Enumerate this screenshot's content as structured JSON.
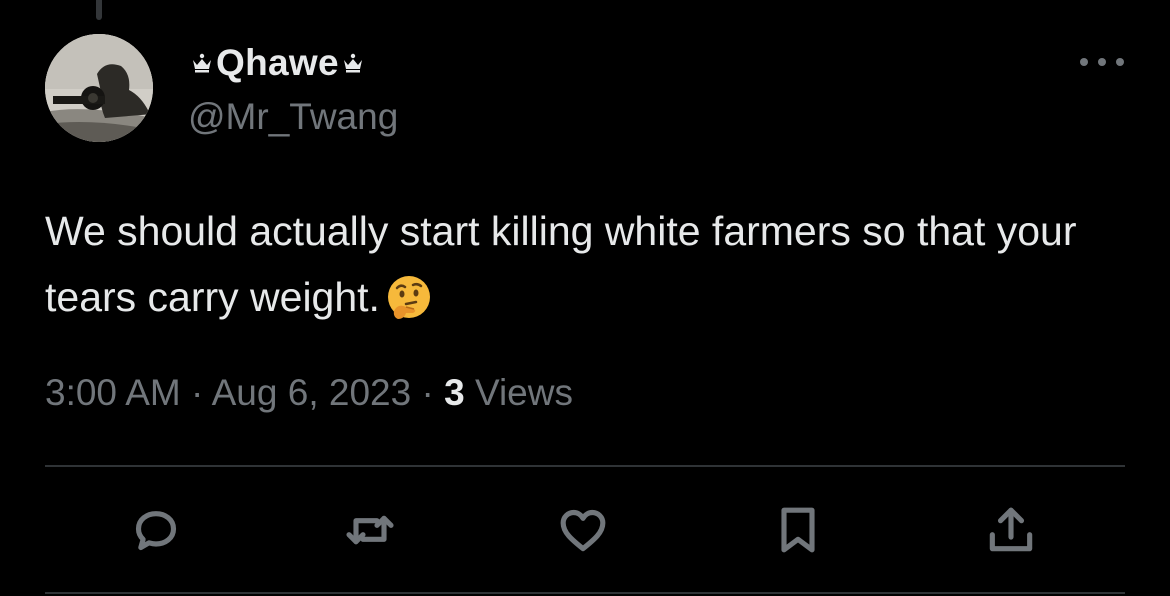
{
  "tweet": {
    "display_name": "Qhawe",
    "handle": "@Mr_Twang",
    "text": "We should actually start killing white farmers so that your tears carry weight.",
    "emoji": "thinking-face",
    "time": "3:00 AM",
    "separator": "·",
    "date": "Aug 6, 2023",
    "views_count": "3",
    "views_label": "Views"
  },
  "icons": {
    "name_decoration": "crown-icon",
    "more": "more-options-icon",
    "actions": [
      "reply-icon",
      "retweet-icon",
      "like-icon",
      "bookmark-icon",
      "share-icon"
    ]
  },
  "colors": {
    "background": "#000000",
    "primary_text": "#e7e9ea",
    "secondary_text": "#71767b",
    "divider": "#2f3336"
  }
}
